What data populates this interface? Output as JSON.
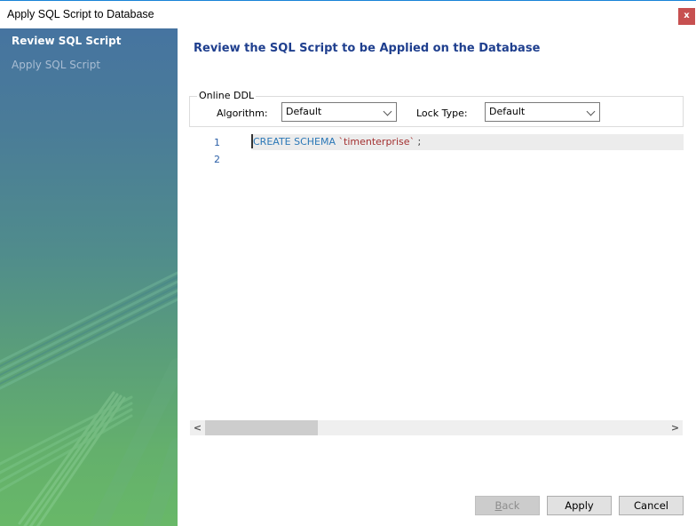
{
  "window": {
    "title": "Apply SQL Script to Database",
    "close_label": "x"
  },
  "sidebar": {
    "items": [
      {
        "label": "Review SQL Script",
        "active": true
      },
      {
        "label": "Apply SQL Script",
        "active": false
      }
    ]
  },
  "main": {
    "heading": "Review the SQL Script to be Applied on the Database",
    "online_ddl": {
      "legend": "Online DDL",
      "algorithm_label": "Algorithm:",
      "algorithm_value": "Default",
      "lock_type_label": "Lock Type:",
      "lock_type_value": "Default"
    },
    "editor": {
      "lines": [
        {
          "number": "1",
          "keyword": "CREATE SCHEMA",
          "identifier": "`timenterprise`",
          "terminator": ";"
        },
        {
          "number": "2"
        }
      ]
    },
    "scrollbar": {
      "left_arrow": "<",
      "right_arrow": ">",
      "thumb_position": 0.0
    }
  },
  "footer": {
    "back_label_rest": "ack",
    "back_label_mnemonic": "B",
    "apply_label": "Apply",
    "cancel_label": "Cancel"
  },
  "colors": {
    "heading": "#1f3f8e",
    "keyword": "#2b78b7",
    "string": "#a33030",
    "close_button": "#c75050",
    "title_border": "#1883d7"
  }
}
